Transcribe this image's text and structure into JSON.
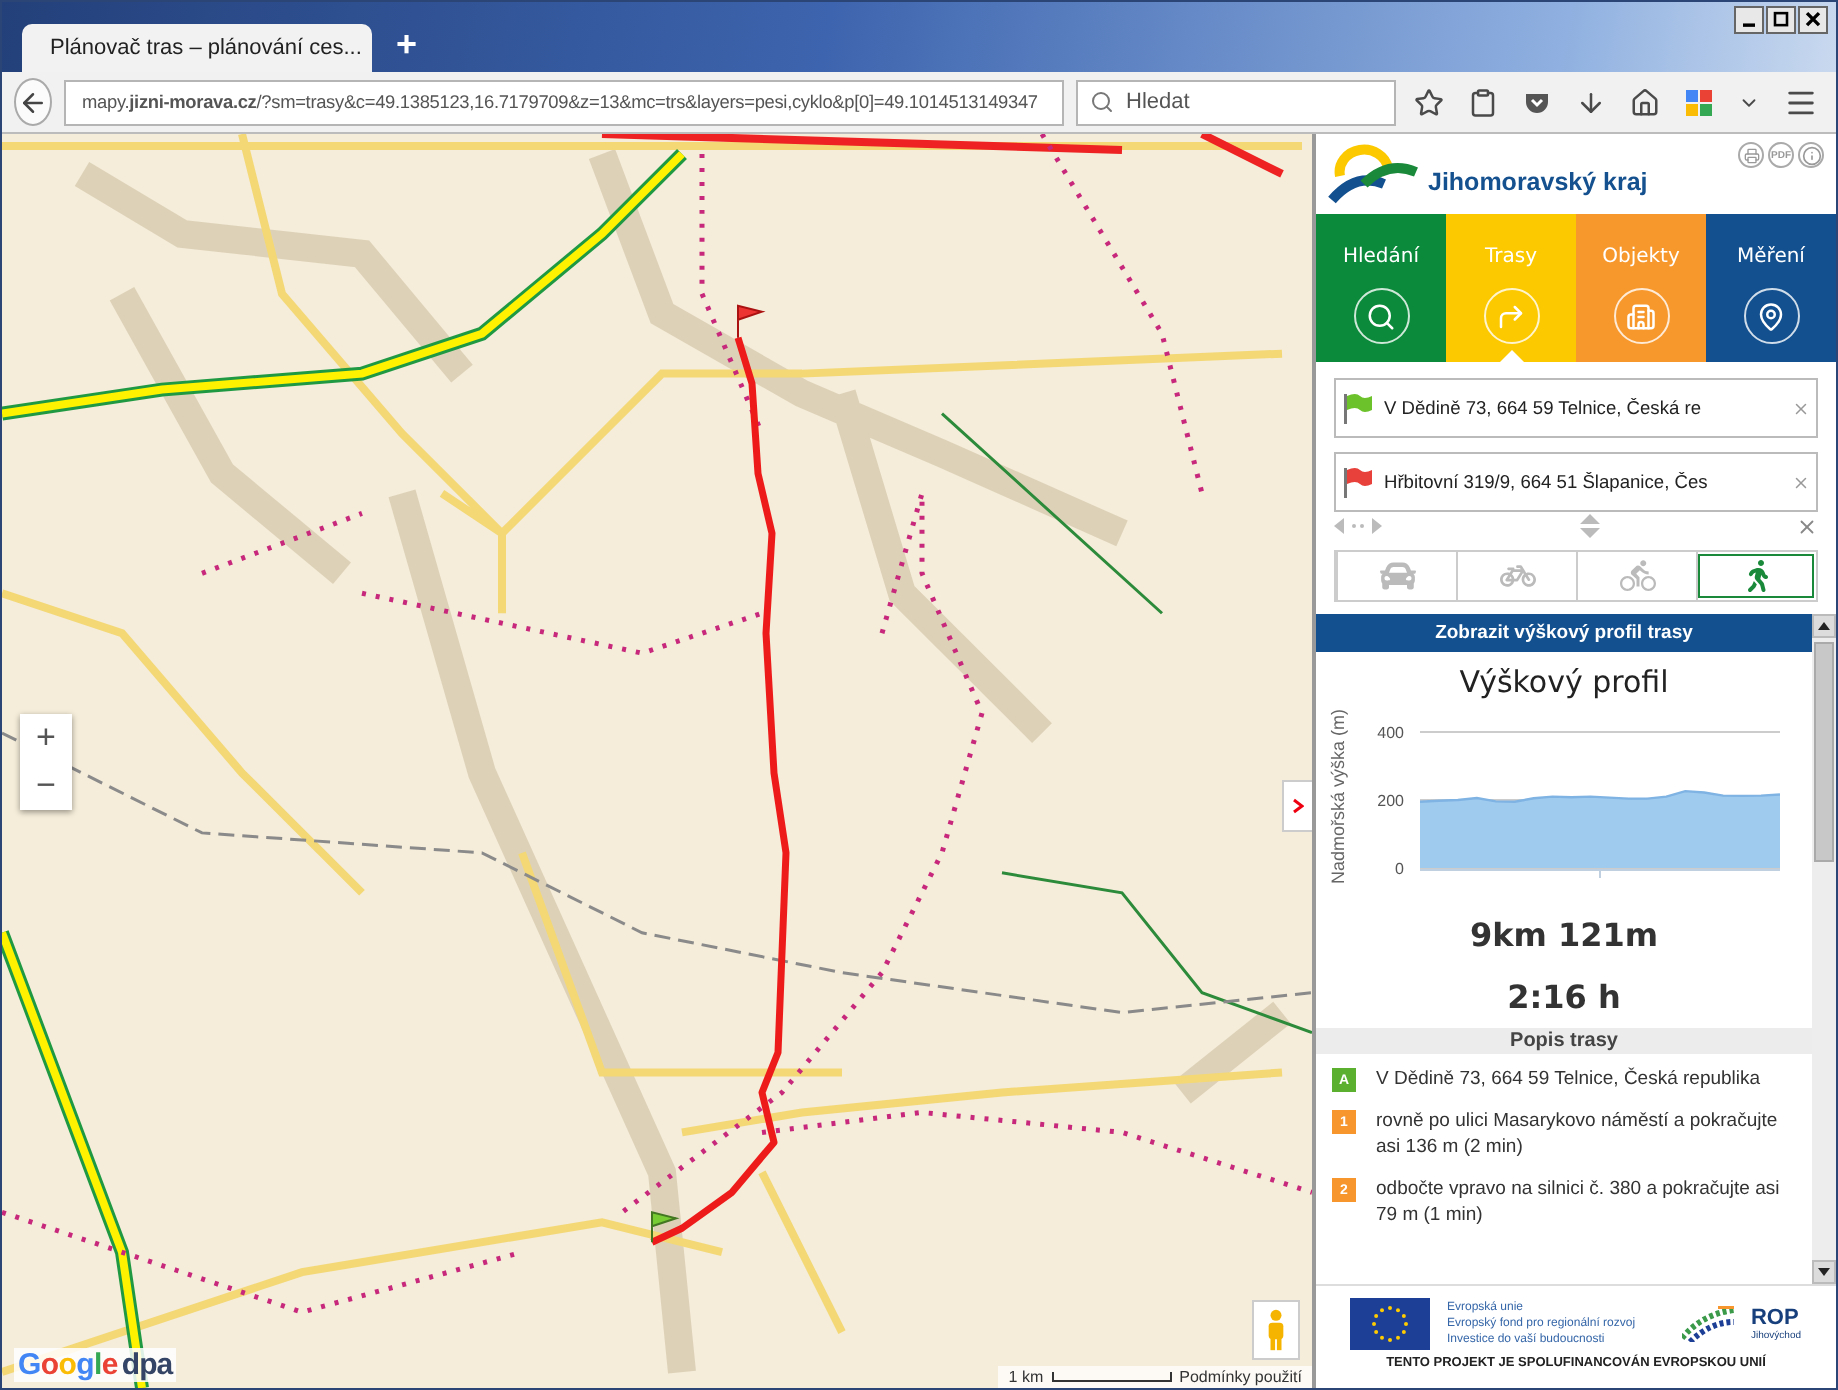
{
  "browser": {
    "tab_title": "Plánovač tras – plánování ces...",
    "new_tab": "+",
    "url": "mapy.**jizni-morava.cz**/?sm=trasy&c=49.1385123,16.7179709&z=13&mc=trs&layers=pesi,cyklo&p[0]=49.1014513149347",
    "search_placeholder": "Hledat"
  },
  "map": {
    "zoom_in": "+",
    "zoom_out": "−",
    "google": "Google",
    "dpa": "dpa",
    "scale": "1 km",
    "terms": "Podmínky použití"
  },
  "panel": {
    "brand": "Jihomoravský kraj",
    "pdf": "PDF",
    "tabs": [
      {
        "label": "Hledání",
        "selected": false,
        "color": "#0b8a3b",
        "kind": "search"
      },
      {
        "label": "Trasy",
        "selected": true,
        "color": "#fcc900",
        "kind": "routes"
      },
      {
        "label": "Objekty",
        "selected": false,
        "color": "#f7982d",
        "kind": "objects"
      },
      {
        "label": "Měření",
        "selected": false,
        "color": "#13508f",
        "kind": "measure"
      }
    ],
    "waypoints": [
      {
        "kind": "start",
        "value": "V Dědině 73, 664 59 Telnice, Česká re"
      },
      {
        "kind": "end",
        "value": "Hřbitovní 319/9, 664 51 Šlapanice, Čes"
      }
    ],
    "modes": [
      {
        "kind": "car",
        "selected": false
      },
      {
        "kind": "road-bike",
        "selected": false
      },
      {
        "kind": "mtb",
        "selected": false
      },
      {
        "kind": "walk",
        "selected": true
      }
    ],
    "profile_button": "Zobrazit výškový profil trasy",
    "profile": {
      "title": "Výškový profil",
      "chart_data": {
        "type": "area",
        "ylabel": "Nadmořská výška (m)",
        "ylim": [
          0,
          400
        ],
        "yticks": [
          0,
          200,
          400
        ],
        "values": [
          195,
          198,
          200,
          206,
          196,
          195,
          205,
          210,
          208,
          210,
          207,
          204,
          204,
          210,
          226,
          222,
          213,
          212,
          213,
          216
        ]
      }
    },
    "distance": "9km 121m",
    "duration": "2:16 h",
    "steps_header": "Popis trasy",
    "steps": [
      {
        "kind": "start",
        "marker": "A",
        "text": "V Dědině 73, 664 59 Telnice, Česká republika"
      },
      {
        "kind": "turn",
        "marker": "1",
        "text": "rovně po ulici Masarykovo náměstí a pokračujte asi 136 m (2 min)"
      },
      {
        "kind": "turn",
        "marker": "2",
        "text": "odbočte vpravo na silnici č. 380 a pokračujte asi 79 m (1 min)"
      }
    ],
    "footer": {
      "eu_lines": [
        "Evropská unie",
        "Evropský fond pro regionální rozvoj",
        "Investice do vaší budoucnosti"
      ],
      "rop": "ROP",
      "rop_sub": "Jihovýchod",
      "notice": "TENTO PROJEKT JE SPOLUFINANCOVÁN EVROPSKOU UNIÍ"
    }
  }
}
